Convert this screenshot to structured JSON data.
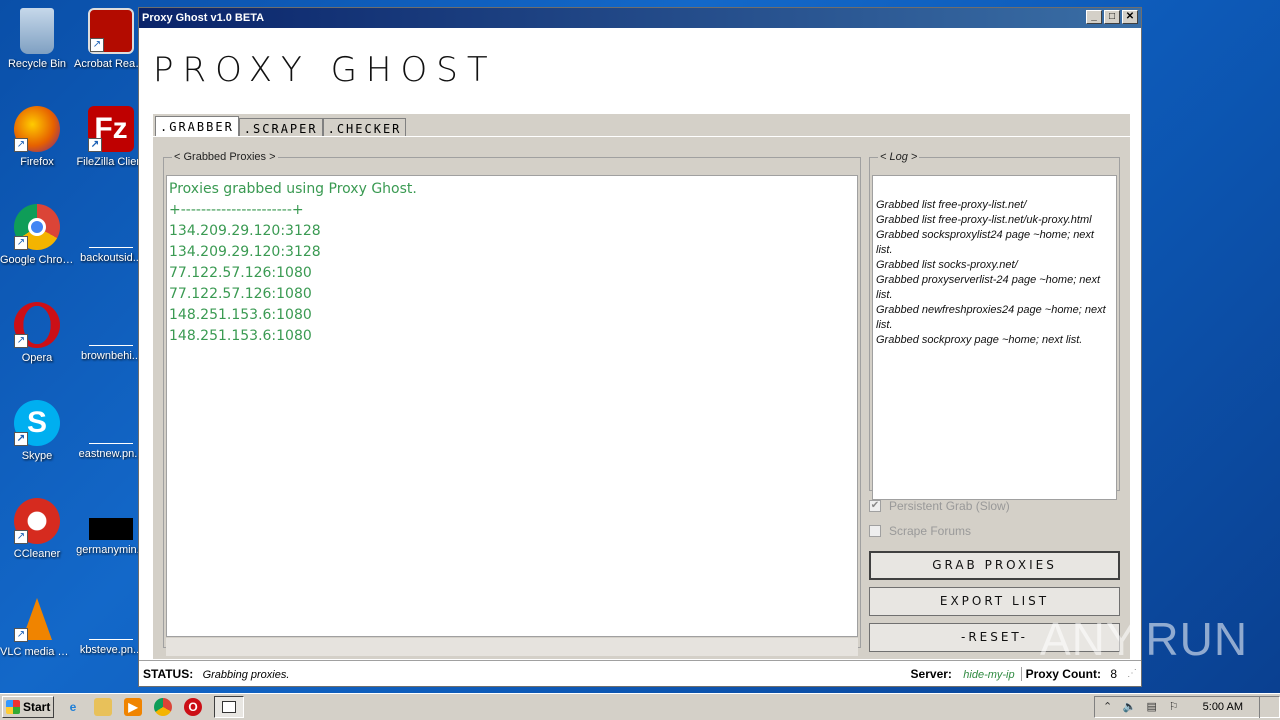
{
  "desktop": {
    "icons": [
      {
        "label": "Recycle Bin",
        "icon": "recycle-bin-icon",
        "color": "#8aa9c8"
      },
      {
        "label": "Acrobat Reader DC",
        "icon": "acrobat-icon",
        "color": "#b30b00"
      },
      {
        "label": "Firefox",
        "icon": "firefox-icon",
        "color": "#e66000"
      },
      {
        "label": "FileZilla Client",
        "icon": "filezilla-icon",
        "color": "#bf0000"
      },
      {
        "label": "Google Chrome",
        "icon": "chrome-icon",
        "color": "#4285f4"
      },
      {
        "label": "backoutsid...",
        "icon": "file-icon",
        "color": "#ffffff"
      },
      {
        "label": "Opera",
        "icon": "opera-icon",
        "color": "#cc0f16"
      },
      {
        "label": "brownbehi...",
        "icon": "file-icon",
        "color": "#ffffff"
      },
      {
        "label": "Skype",
        "icon": "skype-icon",
        "color": "#00aff0"
      },
      {
        "label": "eastnew.pn...",
        "icon": "file-icon",
        "color": "#ffffff"
      },
      {
        "label": "CCleaner",
        "icon": "ccleaner-icon",
        "color": "#d62b1f"
      },
      {
        "label": "germanymin...",
        "icon": "image-file-icon",
        "color": "#000000"
      },
      {
        "label": "VLC media player",
        "icon": "vlc-icon",
        "color": "#f08400"
      },
      {
        "label": "kbsteve.pn...",
        "icon": "file-icon",
        "color": "#ffffff"
      }
    ]
  },
  "window": {
    "title": "Proxy Ghost v1.0 BETA",
    "controls": {
      "minimize": "_",
      "maximize": "□",
      "close": "✕"
    }
  },
  "app": {
    "title": "PROXY GHOST",
    "tabs": [
      ".GRABBER",
      ".SCRAPER",
      ".CHECKER"
    ],
    "active_tab": ".GRABBER",
    "grabbed": {
      "legend": "< Grabbed Proxies >",
      "lines": [
        "Proxies grabbed using Proxy Ghost.",
        "+----------------------+",
        "134.209.29.120:3128",
        "134.209.29.120:3128",
        "77.122.57.126:1080",
        "77.122.57.126:1080",
        "148.251.153.6:1080",
        "148.251.153.6:1080"
      ]
    },
    "log": {
      "legend": "< Log >",
      "entries": [
        "Grabbed list free-proxy-list.net/",
        "Grabbed list free-proxy-list.net/uk-proxy.html",
        "Grabbed socksproxylist24 page ~home; next list.",
        "Grabbed list socks-proxy.net/",
        "Grabbed proxyserverlist-24 page ~home; next list.",
        "Grabbed newfreshproxies24 page ~home; next list.",
        "Grabbed sockproxy page ~home; next list."
      ]
    },
    "options": {
      "persistent_grab": "Persistent Grab (Slow)",
      "scrape_forums": "Scrape Forums"
    },
    "buttons": {
      "grab": "GRAB PROXIES",
      "export": "EXPORT LIST",
      "reset": "-RESET-"
    },
    "status": {
      "label": "STATUS:",
      "value": "Grabbing proxies.",
      "server_label": "Server:",
      "server_value": "hide-my-ip",
      "count_label": "Proxy Count:",
      "count_value": "8"
    }
  },
  "taskbar": {
    "start_label": "Start",
    "clock": "5:00 AM"
  },
  "watermark": "ANY.RUN"
}
